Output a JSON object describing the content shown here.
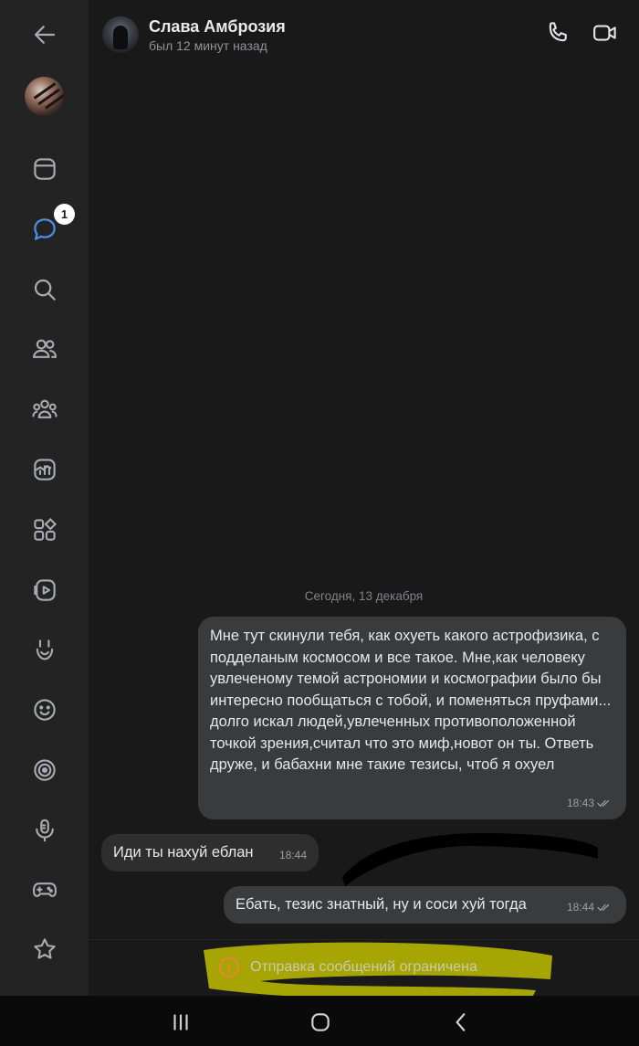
{
  "colors": {
    "accent": "#4a90e2",
    "icon": "#a8acb2",
    "highlight": "#c6c400",
    "warning": "#e8873a"
  },
  "sidebar": {
    "items": [
      {
        "name": "back-icon"
      },
      {
        "name": "profile-avatar"
      },
      {
        "name": "news-icon"
      },
      {
        "name": "messages-icon",
        "badge": "1"
      },
      {
        "name": "search-icon"
      },
      {
        "name": "friends-icon"
      },
      {
        "name": "communities-icon"
      },
      {
        "name": "stats-icon"
      },
      {
        "name": "services-icon"
      },
      {
        "name": "video-icon"
      },
      {
        "name": "clips-icon"
      },
      {
        "name": "stickers-icon"
      },
      {
        "name": "games-target-icon"
      },
      {
        "name": "podcasts-icon"
      },
      {
        "name": "gamepad-icon"
      },
      {
        "name": "favorites-icon"
      }
    ]
  },
  "header": {
    "name": "Слава Амброзия",
    "status": "был 12 минут назад"
  },
  "chat": {
    "date_separator": "Сегодня, 13 декабря",
    "messages": [
      {
        "direction": "out",
        "text": "Мне тут скинули тебя, как охуеть какого астрофизика, с подделаным космосом и все такое. Мне,как человеку увлеченому темой астрономии и космографии было бы интересно пообщаться с тобой, и поменяться пруфами... долго искал людей,увлеченных противоположенной точкой зрения,считал что это миф,новот он ты. Ответь друже, и бабахни мне такие тезисы, чтоб я охуел",
        "time": "18:43",
        "read": true
      },
      {
        "direction": "in",
        "text": "Иди ты нахуй еблан",
        "time": "18:44"
      },
      {
        "direction": "out",
        "text": "Ебать, тезис знатный, ну и соси хуй тогда",
        "time": "18:44",
        "read": true
      }
    ]
  },
  "footer": {
    "restriction_text": "Отправка сообщений ограничена"
  }
}
